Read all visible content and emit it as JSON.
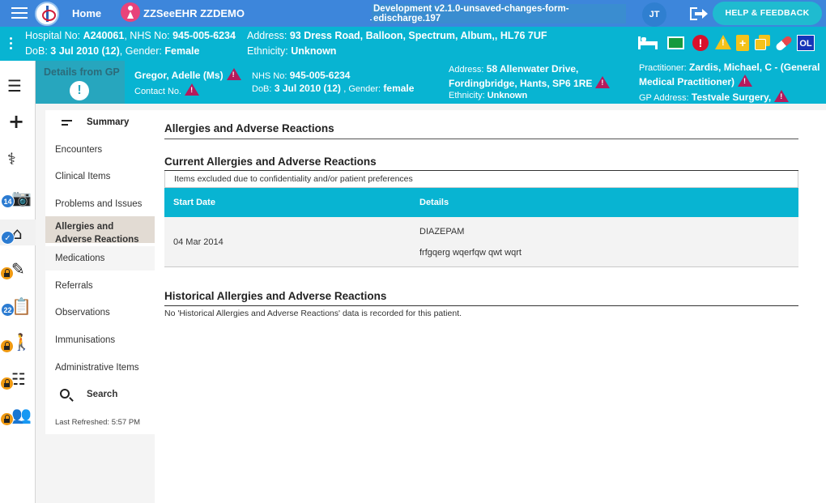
{
  "topbar": {
    "home_label": "Home",
    "patient_label": "ZZSeeEHR ZZDEMO",
    "environment": "Development v2.1.0-unsaved-changes-form-edischarge.197",
    "user_initials": "JT",
    "help_label": "HELP & FEEDBACK"
  },
  "banner": {
    "hospital_no_label": "Hospital No:",
    "hospital_no": "A240061",
    "nhs_no_label": "NHS No:",
    "nhs_no": "945-005-6234",
    "address_label": "Address:",
    "address": "93 Dress Road, Balloon, Spectrum, Album,, HL76 7UF",
    "dob_label": "DoB:",
    "dob": "3 Jul 2010 (12)",
    "gender_label": "Gender:",
    "gender": "Female",
    "ethnicity_label": "Ethnicity:",
    "ethnicity": "Unknown",
    "flag_ol": "OL",
    "flag_alert": "!"
  },
  "rail": {
    "badge_photos": "14",
    "badge_tasks": "22"
  },
  "gp": {
    "title": "Details from GP",
    "excl": "!",
    "name": "Gregor, Adelle (Ms)",
    "contact_label": "Contact No.",
    "nhs_label": "NHS No:",
    "nhs": "945-005-6234",
    "dob_label": "DoB:",
    "dob": "3 Jul 2010 (12)",
    "gender_label": ", Gender:",
    "gender": "female",
    "address_label": "Address:",
    "address_line1": "58 Allenwater Drive,",
    "address_line2": "Fordingbridge, Hants, SP6 1RE",
    "ethnicity_label": "Ethnicity:",
    "ethnicity": "Unknown",
    "practitioner_label": "Practitioner:",
    "practitioner_line1": "Zardis, Michael, C - (General",
    "practitioner_line2": "Medical Practitioner)",
    "gp_address_label": "GP Address:",
    "gp_address": "Testvale Surgery,"
  },
  "nav": {
    "summary": "Summary",
    "items": [
      "Encounters",
      "Clinical Items",
      "Problems and Issues",
      "Allergies and Adverse Reactions",
      "Medications",
      "Referrals",
      "Observations",
      "Immunisations",
      "Administrative Items"
    ],
    "search": "Search",
    "last_refreshed": "Last Refreshed: 5:57 PM"
  },
  "main": {
    "page_title": "Allergies and Adverse Reactions",
    "current_title": "Current Allergies and Adverse Reactions",
    "exclusion_note": "Items excluded due to confidentiality and/or patient preferences",
    "columns": [
      "Start Date",
      "Details"
    ],
    "rows": [
      {
        "start_date": "04 Mar 2014",
        "detail_name": "DIAZEPAM",
        "detail_note": "frfgqerg wqerfqw qwt wqrt"
      }
    ],
    "historical_title": "Historical Allergies and Adverse Reactions",
    "historical_empty": "No 'Historical Allergies and Adverse Reactions' data is recorded for this patient."
  }
}
